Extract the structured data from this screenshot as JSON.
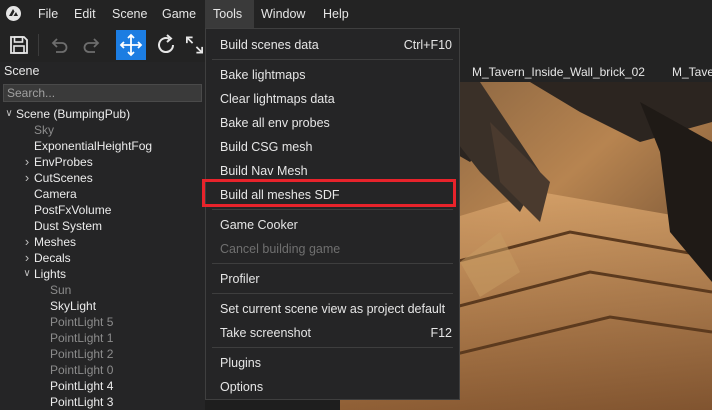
{
  "menubar": {
    "items": [
      "File",
      "Edit",
      "Scene",
      "Game",
      "Tools",
      "Window",
      "Help"
    ],
    "active": "Tools"
  },
  "toolbar": {
    "buttons": [
      "save-icon",
      "undo-icon",
      "redo-icon",
      "move-icon",
      "rotate-icon",
      "scale-icon"
    ],
    "selected": "move-icon",
    "accent": "#1c7de2"
  },
  "scene_panel": {
    "title": "Scene",
    "search_placeholder": "Search...",
    "tree": [
      {
        "label": "Scene (BumpingPub)",
        "arrow": "expanded",
        "style": "bright"
      },
      {
        "label": "Sky",
        "arrow": "none",
        "style": "dim"
      },
      {
        "label": "ExponentialHeightFog",
        "arrow": "none",
        "style": "bright"
      },
      {
        "label": "EnvProbes",
        "arrow": "collapsed",
        "style": "bright"
      },
      {
        "label": "CutScenes",
        "arrow": "collapsed",
        "style": "bright"
      },
      {
        "label": "Camera",
        "arrow": "none",
        "style": "bright"
      },
      {
        "label": "PostFxVolume",
        "arrow": "none",
        "style": "bright"
      },
      {
        "label": "Dust System",
        "arrow": "none",
        "style": "bright"
      },
      {
        "label": "Meshes",
        "arrow": "collapsed",
        "style": "bright"
      },
      {
        "label": "Decals",
        "arrow": "collapsed",
        "style": "bright"
      },
      {
        "label": "Lights",
        "arrow": "expanded",
        "style": "bright"
      },
      {
        "label": "Sun",
        "arrow": "none",
        "style": "dim"
      },
      {
        "label": "SkyLight",
        "arrow": "none",
        "style": "bright"
      },
      {
        "label": "PointLight 5",
        "arrow": "none",
        "style": "dim"
      },
      {
        "label": "PointLight 1",
        "arrow": "none",
        "style": "dim"
      },
      {
        "label": "PointLight 2",
        "arrow": "none",
        "style": "dim"
      },
      {
        "label": "PointLight 0",
        "arrow": "none",
        "style": "dim"
      },
      {
        "label": "PointLight 4",
        "arrow": "none",
        "style": "bright"
      },
      {
        "label": "PointLight 3",
        "arrow": "none",
        "style": "bright"
      }
    ]
  },
  "tabs": [
    "M_Tavern_Inside_Wall_brick_02",
    "M_Tave"
  ],
  "tools_menu": {
    "items": [
      {
        "label": "Build scenes data",
        "shortcut": "Ctrl+F10",
        "enabled": true
      },
      {
        "separator": true
      },
      {
        "label": "Bake lightmaps",
        "enabled": true
      },
      {
        "label": "Clear lightmaps data",
        "enabled": true
      },
      {
        "label": "Bake all env probes",
        "enabled": true
      },
      {
        "label": "Build CSG mesh",
        "enabled": true
      },
      {
        "label": "Build Nav Mesh",
        "enabled": true
      },
      {
        "label": "Build all meshes SDF",
        "enabled": true,
        "highlighted": true
      },
      {
        "separator": true
      },
      {
        "label": "Game Cooker",
        "enabled": true
      },
      {
        "label": "Cancel building game",
        "enabled": false
      },
      {
        "separator": true
      },
      {
        "label": "Profiler",
        "enabled": true
      },
      {
        "separator": true
      },
      {
        "label": "Set current scene view as project default",
        "enabled": true
      },
      {
        "label": "Take screenshot",
        "shortcut": "F12",
        "enabled": true
      },
      {
        "separator": true
      },
      {
        "label": "Plugins",
        "enabled": true
      },
      {
        "label": "Options",
        "enabled": true
      }
    ],
    "highlight_color": "#e8232b"
  }
}
